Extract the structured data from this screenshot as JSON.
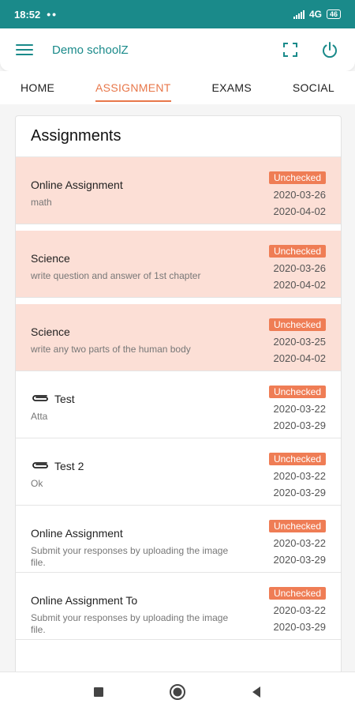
{
  "status": {
    "time": "18:52",
    "dots": "••",
    "network": "4G",
    "battery": "46"
  },
  "app": {
    "title": "Demo schoolZ"
  },
  "tabs": [
    {
      "label": "HOME"
    },
    {
      "label": "ASSIGNMENT"
    },
    {
      "label": "EXAMS"
    },
    {
      "label": "SOCIAL"
    }
  ],
  "list": {
    "title": "Assignments",
    "items": [
      {
        "name": "Online Assignment",
        "desc": "math",
        "status": "Unchecked",
        "date1": "2020-03-26",
        "date2": "2020-04-02"
      },
      {
        "name": "Science",
        "desc": "write question and answer of 1st chapter",
        "status": "Unchecked",
        "date1": "2020-03-26",
        "date2": "2020-04-02"
      },
      {
        "name": "Science",
        "desc": "write any two parts of the human body",
        "status": "Unchecked",
        "date1": "2020-03-25",
        "date2": "2020-04-02"
      },
      {
        "name": "Test",
        "desc": "Atta",
        "status": "Unchecked",
        "date1": "2020-03-22",
        "date2": "2020-03-29"
      },
      {
        "name": "Test 2",
        "desc": "Ok",
        "status": "Unchecked",
        "date1": "2020-03-22",
        "date2": "2020-03-29"
      },
      {
        "name": "Online Assignment",
        "desc": "Submit your responses by uploading the image file.",
        "status": "Unchecked",
        "date1": "2020-03-22",
        "date2": "2020-03-29"
      },
      {
        "name": "Online Assignment To",
        "desc": "Submit your responses by uploading the image file.",
        "status": "Unchecked",
        "date1": "2020-03-22",
        "date2": "2020-03-29"
      }
    ]
  },
  "colors": {
    "primary": "#1a8a8a",
    "accent": "#e8774a",
    "badge": "#ef7d55",
    "highlight_row": "#fcdfd6"
  }
}
